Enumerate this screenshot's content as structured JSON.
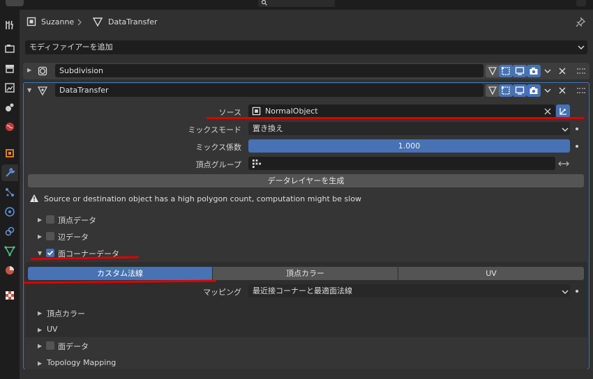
{
  "header": {
    "search_placeholder": "",
    "breadcrumb": {
      "object_name": "Suzanne",
      "modifier_name": "DataTransfer"
    }
  },
  "add_modifier": {
    "label": "モディファイアーを追加"
  },
  "modifiers": [
    {
      "name": "Subdivision",
      "expanded": false
    },
    {
      "name": "DataTransfer",
      "expanded": true
    }
  ],
  "datatransfer": {
    "source_label": "ソース",
    "source_value": "NormalObject",
    "mix_mode_label": "ミックスモード",
    "mix_mode_value": "置き換え",
    "mix_factor_label": "ミックス係数",
    "mix_factor_value": "1.000",
    "vertex_group_label": "頂点グループ",
    "vertex_group_value": "",
    "generate_layers_label": "データレイヤーを生成",
    "warning_text": "Source or destination object has a high polygon count, computation might be slow",
    "sections": {
      "vertex_data": "頂点データ",
      "edge_data": "辺データ",
      "face_corner_data": "面コーナーデータ"
    },
    "face_corner_tabs": [
      "カスタム法線",
      "頂点カラー",
      "UV"
    ],
    "mapping_label": "マッピング",
    "mapping_value": "最近接コーナーと最適面法線",
    "subsections": {
      "vertex_color": "頂点カラー",
      "uv": "UV",
      "face_data": "面データ",
      "topology_mapping": "Topology Mapping"
    }
  },
  "colors": {
    "accent": "#4772b3",
    "annotation_red": "#e00000",
    "panel_bg": "#303030"
  }
}
